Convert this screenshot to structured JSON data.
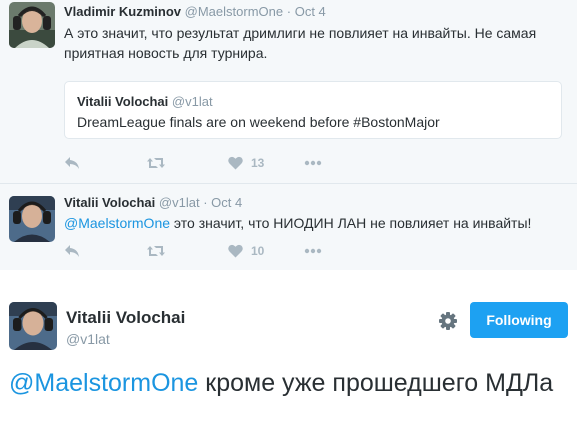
{
  "thread": [
    {
      "fullname": "Vladimir Kuzminov",
      "username": "@MaelstormOne",
      "dot": "·",
      "time": "Oct 4",
      "text": "А это значит, что результат дримлиги не повлияет на инвайты. Не самая приятная новость для турнира.",
      "quote": {
        "fullname": "Vitalii Volochai",
        "username": "@v1lat",
        "text": "DreamLeague finals are on weekend before #BostonMajor"
      },
      "actions": {
        "reply_icon": "reply-icon",
        "retweet_icon": "retweet-icon",
        "like_icon": "heart-icon",
        "likes": "13",
        "more_icon": "more-icon"
      }
    },
    {
      "fullname": "Vitalii Volochai",
      "username": "@v1lat",
      "dot": "·",
      "time": "Oct 4",
      "mention": "@MaelstormOne",
      "text": " это значит, что НИОДИН ЛАН не повлияет на инвайты!",
      "actions": {
        "reply_icon": "reply-icon",
        "retweet_icon": "retweet-icon",
        "like_icon": "heart-icon",
        "likes": "10",
        "more_icon": "more-icon"
      }
    }
  ],
  "main_tweet": {
    "fullname": "Vitalii Volochai",
    "username": "@v1lat",
    "follow_label": "Following",
    "gear_icon": "gear-icon",
    "mention": "@MaelstormOne",
    "text": " кроме уже прошедшего МДЛа"
  },
  "colors": {
    "accent": "#1da1f2",
    "link": "#1b95e0",
    "muted": "#8899a6",
    "thread_bg": "#f5f8fa"
  }
}
